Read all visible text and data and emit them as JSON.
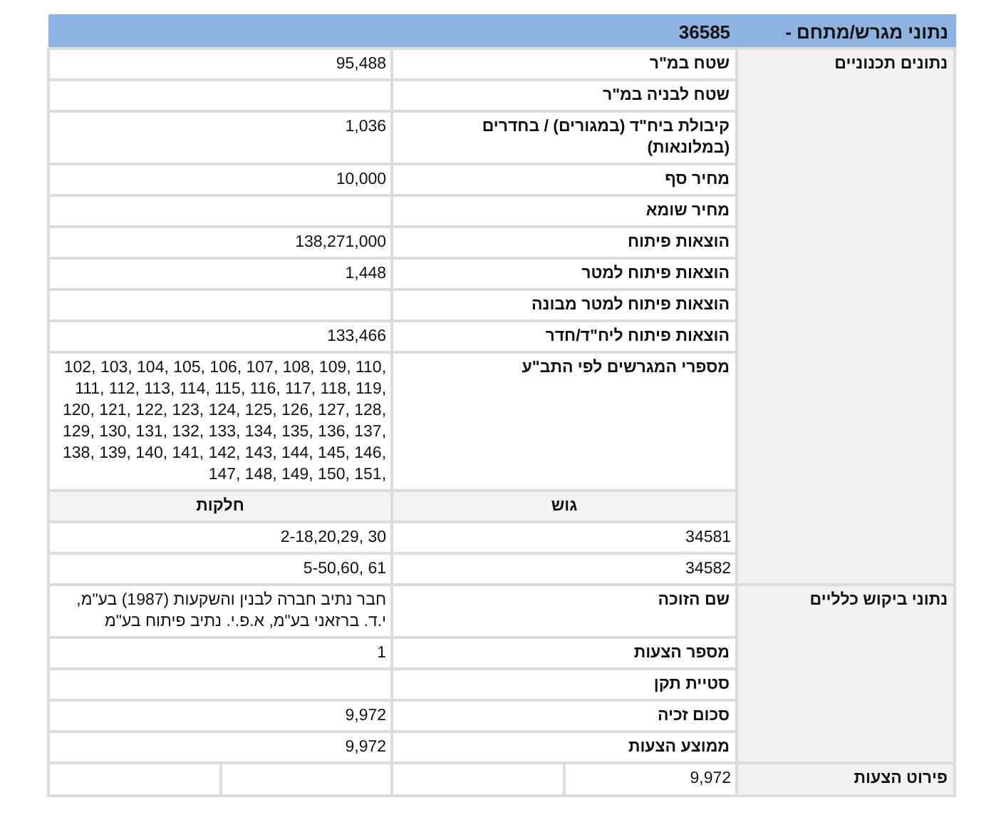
{
  "header": {
    "title": "נתוני מגרש/מתחם -",
    "number": "36585"
  },
  "sections": [
    {
      "title": "נתונים תכנוניים",
      "rows": [
        {
          "kind": "field",
          "label": "שטח במ\"ר",
          "value": "95,488"
        },
        {
          "kind": "field",
          "label": "שטח לבניה במ\"ר"
        },
        {
          "kind": "field",
          "label": "קיבולת ביח\"ד (במגורים) / בחדרים (במלונאות)",
          "value": "1,036"
        },
        {
          "kind": "field",
          "label": "מחיר סף",
          "value": "10,000"
        },
        {
          "kind": "field",
          "label": "מחיר שומא"
        },
        {
          "kind": "field",
          "label": "הוצאות פיתוח",
          "value": "138,271,000"
        },
        {
          "kind": "field",
          "label": "הוצאות פיתוח למטר",
          "value": "1,448"
        },
        {
          "kind": "field",
          "label": "הוצאות פיתוח למטר מבונה"
        },
        {
          "kind": "field",
          "label": "הוצאות פיתוח ליח\"ד/חדר",
          "value": "133,466"
        },
        {
          "kind": "field",
          "label": "מספרי המגרשים לפי התב\"ע",
          "value": "102, 103, 104, 105, 106, 107, 108, 109, 110, 111, 112, 113, 114, 115, 116, 117, 118, 119, 120, 121, 122, 123, 124, 125, 126, 127, 128, 129, 130, 131, 132, 133, 134, 135, 136, 137, 138, 139, 140, 141, 142, 143, 144, 145, 146, 147, 148, 149, 150, 151,"
        },
        {
          "kind": "table_header",
          "cells": [
            "גוש",
            "חלקות"
          ]
        },
        {
          "kind": "pair",
          "cells": [
            "34581",
            "2-18,20,29, 30"
          ]
        },
        {
          "kind": "pair",
          "cells": [
            "34582",
            "5-50,60, 61"
          ]
        }
      ]
    },
    {
      "title": "נתוני ביקוש כלליים",
      "rows": [
        {
          "kind": "field",
          "label": "שם הזוכה",
          "value": "חבר נתיב חברה לבנין והשקעות (1987) בע\"מ, י.ד. ברזאני בע\"מ, א.פ.י. נתיב פיתוח בע\"מ"
        },
        {
          "kind": "field",
          "label": "מספר הצעות",
          "value": "1"
        },
        {
          "kind": "field",
          "label": "סטיית תקן"
        },
        {
          "kind": "field",
          "label": "סכום זכיה",
          "value": "9,972"
        },
        {
          "kind": "field",
          "label": "ממוצע הצעות",
          "value": "9,972"
        }
      ]
    },
    {
      "title": "פירוט הצעות",
      "rows": [
        {
          "kind": "quad",
          "cells": [
            "9,972"
          ]
        }
      ]
    }
  ]
}
